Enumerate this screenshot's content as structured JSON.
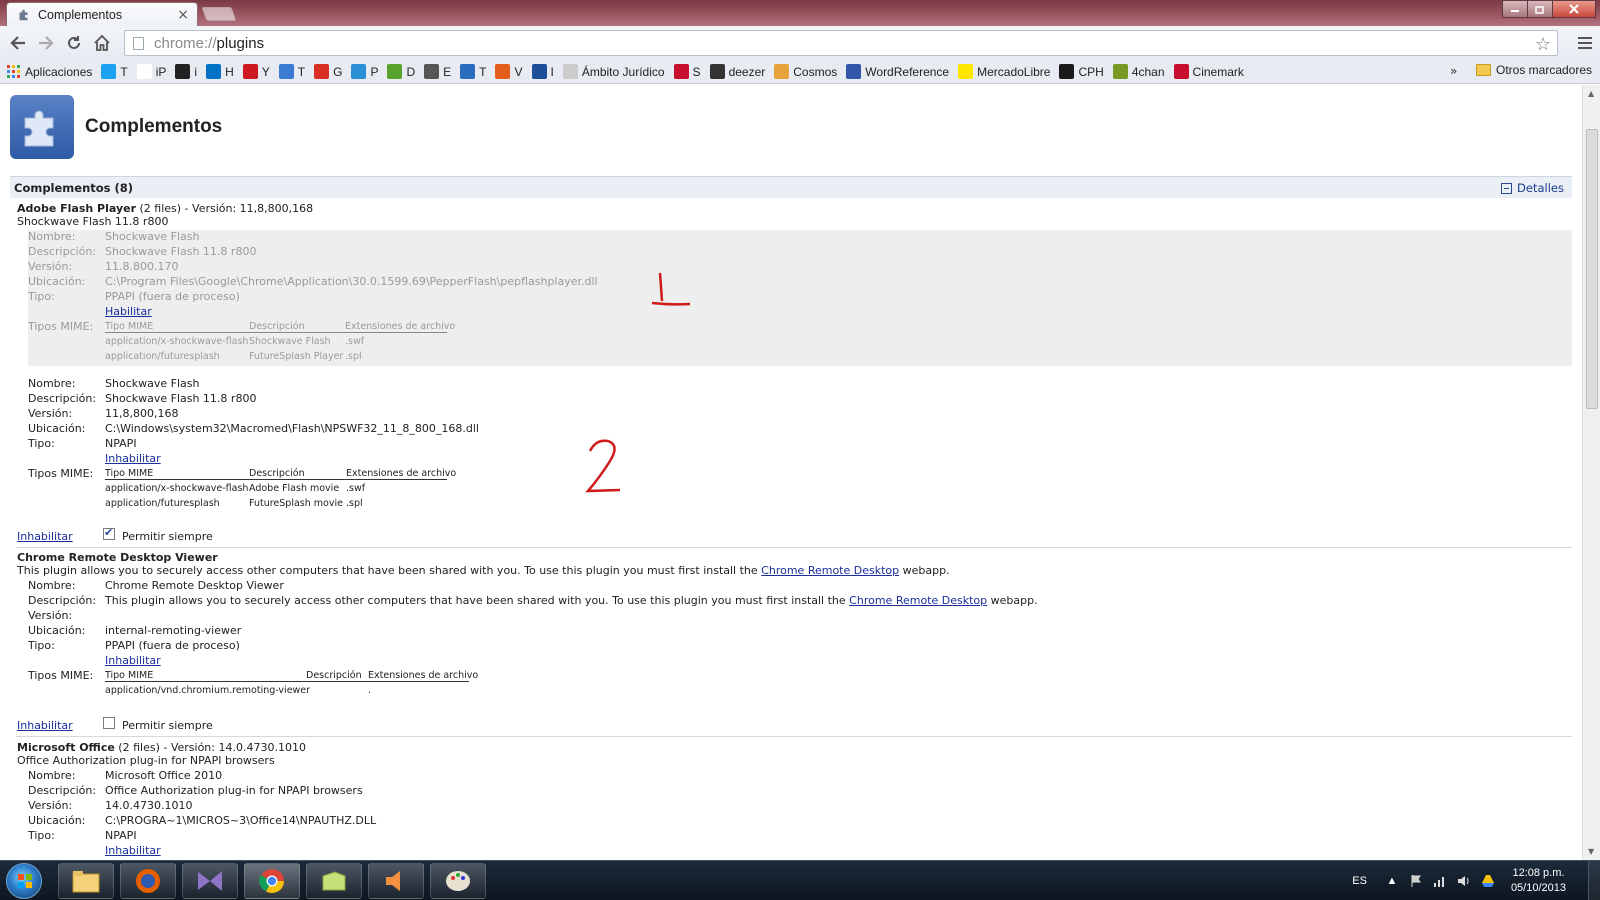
{
  "tab": {
    "title": "Complementos",
    "close": "×"
  },
  "toolbar": {
    "url_scheme": "chrome://",
    "url_host": "plugins"
  },
  "bookmarks": {
    "items": [
      {
        "label": "Aplicaciones",
        "color": "#e34133"
      },
      {
        "label": "T",
        "color": "#1da1f2"
      },
      {
        "label": "iP",
        "color": "#ffffff"
      },
      {
        "label": "i",
        "color": "#222222"
      },
      {
        "label": "H",
        "color": "#0072c6"
      },
      {
        "label": "Y",
        "color": "#cc181e"
      },
      {
        "label": "T",
        "color": "#3b7bd4"
      },
      {
        "label": "G",
        "color": "#d93025"
      },
      {
        "label": "P",
        "color": "#2b8fd6"
      },
      {
        "label": "D",
        "color": "#59a22b"
      },
      {
        "label": "E",
        "color": "#555555"
      },
      {
        "label": "T",
        "color": "#2a6dbf"
      },
      {
        "label": "V",
        "color": "#e45d1a"
      },
      {
        "label": "I",
        "color": "#1d4e9a"
      },
      {
        "label": "Ámbito Jurídico",
        "color": "#cccccc"
      },
      {
        "label": "S",
        "color": "#c8102e"
      },
      {
        "label": "deezer",
        "color": "#333333"
      },
      {
        "label": "Cosmos",
        "color": "#e6a23c"
      },
      {
        "label": "WordReference",
        "color": "#3355aa"
      },
      {
        "label": "MercadoLibre",
        "color": "#ffe600"
      },
      {
        "label": "CPH",
        "color": "#1a1a1a"
      },
      {
        "label": "4chan",
        "color": "#789922"
      },
      {
        "label": "Cinemark",
        "color": "#c8102e"
      }
    ],
    "more": "»",
    "other": "Otros marcadores"
  },
  "page": {
    "title": "Complementos",
    "section_title": "Complementos (8)",
    "details_link": "Detalles"
  },
  "labels": {
    "nombre": "Nombre:",
    "descripcion": "Descripción:",
    "version": "Versión:",
    "ubicacion": "Ubicación:",
    "tipo": "Tipo:",
    "tipos_mime": "Tipos MIME:",
    "mime_col_type": "Tipo MIME",
    "mime_col_desc": "Descripción",
    "mime_col_ext": "Extensiones de archivo",
    "disable": "Inhabilitar",
    "enable": "Habilitar",
    "always_allow": "Permitir siempre"
  },
  "plugins": {
    "flash": {
      "name": "Adobe Flash Player",
      "summary_suffix": " (2 files) - Versión: 11,8,800,168",
      "subtitle": "Shockwave Flash 11.8 r800",
      "files": [
        {
          "nombre": "Shockwave Flash",
          "descripcion": "Shockwave Flash 11.8 r800",
          "version": "11.8.800.170",
          "ubicacion": "C:\\Program Files\\Google\\Chrome\\Application\\30.0.1599.69\\PepperFlash\\pepflashplayer.dll",
          "tipo": "PPAPI (fuera de proceso)",
          "mime": [
            {
              "type": "application/x-shockwave-flash",
              "desc": "Shockwave Flash",
              "ext": ".swf"
            },
            {
              "type": "application/futuresplash",
              "desc": "FutureSplash Player",
              "ext": ".spl"
            }
          ]
        },
        {
          "nombre": "Shockwave Flash",
          "descripcion": "Shockwave Flash 11.8 r800",
          "version": "11,8,800,168",
          "ubicacion": "C:\\Windows\\system32\\Macromed\\Flash\\NPSWF32_11_8_800_168.dll",
          "tipo": "NPAPI",
          "mime": [
            {
              "type": "application/x-shockwave-flash",
              "desc": "Adobe Flash movie",
              "ext": ".swf"
            },
            {
              "type": "application/futuresplash",
              "desc": "FutureSplash movie",
              "ext": ".spl"
            }
          ]
        }
      ],
      "always_allow_checked": true
    },
    "remote": {
      "name": "Chrome Remote Desktop Viewer",
      "desc_pre": "This plugin allows you to securely access other computers that have been shared with you. To use this plugin you must first install the ",
      "desc_link": "Chrome Remote Desktop",
      "desc_post": " webapp.",
      "nombre": "Chrome Remote Desktop Viewer",
      "version": "",
      "ubicacion": "internal-remoting-viewer",
      "tipo": "PPAPI (fuera de proceso)",
      "mime": [
        {
          "type": "application/vnd.chromium.remoting-viewer",
          "desc": "",
          "ext": "."
        }
      ],
      "always_allow_checked": false
    },
    "office": {
      "name": "Microsoft Office",
      "summary_suffix": " (2 files) - Versión: 14.0.4730.1010",
      "subtitle": "Office Authorization plug-in for NPAPI browsers",
      "nombre": "Microsoft Office 2010",
      "descripcion": "Office Authorization plug-in for NPAPI browsers",
      "version": "14.0.4730.1010",
      "ubicacion": "C:\\PROGRA~1\\MICROS~3\\Office14\\NPAUTHZ.DLL",
      "tipo": "NPAPI",
      "link_partial": "Inhabilitar"
    }
  },
  "taskbar": {
    "lang": "ES",
    "time": "12:08 p.m.",
    "date": "05/10/2013"
  }
}
